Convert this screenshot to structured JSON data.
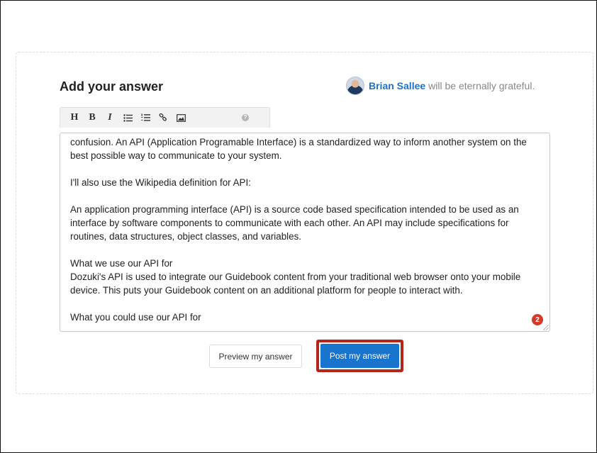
{
  "header": {
    "title": "Add your answer",
    "asker_name": "Brian Sallee",
    "grateful_text": "will be eternally grateful."
  },
  "toolbar": {
    "buttons": [
      {
        "label": "H",
        "icon": "heading-icon"
      },
      {
        "label": "B",
        "icon": "bold-icon"
      },
      {
        "label": "I",
        "icon": "italic-icon"
      },
      {
        "label": "☰",
        "icon": "bullet-list-icon"
      },
      {
        "label": "☰",
        "icon": "numbered-list-icon"
      },
      {
        "label": "%",
        "icon": "link-icon"
      },
      {
        "label": "▣",
        "icon": "image-icon"
      }
    ],
    "help": "?"
  },
  "editor": {
    "paragraphs": [
      "confusion. An API (Application Programable Interface) is a standardized way to inform another system on the best possible way to communicate to your system.",
      "I'll also use the Wikipedia definition for API:",
      "An application programming interface (API) is a source code based specification intended to be used as an interface by software components to communicate with each other. An API may include specifications for routines, data structures, object classes, and variables.",
      "What we use our API for",
      "Dozuki's API is used to integrate our Guidebook content from your traditional web browser onto your mobile device. This puts your Guidebook content on an additional platform for people to interact with.",
      "What you could use our API for"
    ],
    "badge_count": "2"
  },
  "actions": {
    "preview_label": "Preview my answer",
    "post_label": "Post my answer"
  },
  "colors": {
    "accent": "#1874cd",
    "highlight": "#b3261e",
    "badge": "#d33a2c"
  }
}
